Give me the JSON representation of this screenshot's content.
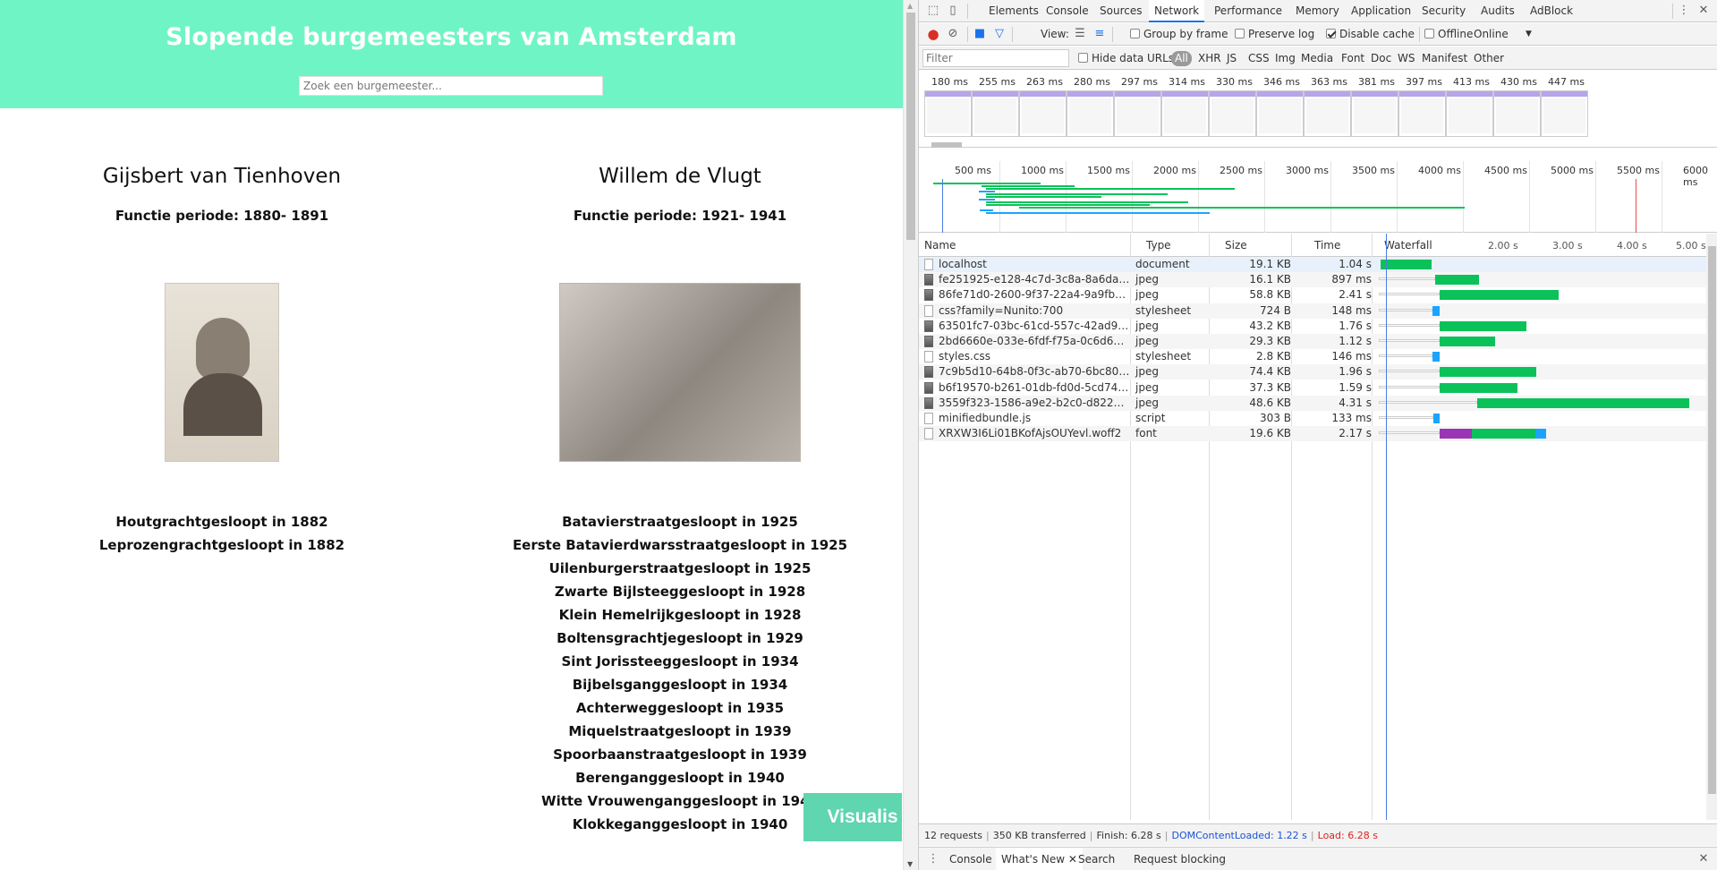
{
  "site": {
    "title": "Slopende burgemeesters van Amsterdam",
    "search_placeholder": "Zoek een burgemeester...",
    "visualis_label": "Visualis"
  },
  "mayors": [
    {
      "name": "Gijsbert van Tienhoven",
      "period": "Functie periode: 1880- 1891",
      "streets": [
        "Houtgrachtgesloopt in 1882",
        "Leprozengrachtgesloopt in 1882"
      ]
    },
    {
      "name": "Willem de Vlugt",
      "period": "Functie periode: 1921- 1941",
      "streets": [
        "Batavierstraatgesloopt in 1925",
        "Eerste Batavierdwarsstraatgesloopt in 1925",
        "Uilenburgerstraatgesloopt in 1925",
        "Zwarte Bijlsteeggesloopt in 1928",
        "Klein Hemelrijkgesloopt in 1928",
        "Boltensgrachtjegesloopt in 1929",
        "Sint Jorissteeggesloopt in 1934",
        "Bijbelsganggesloopt in 1934",
        "Achterweggesloopt in 1935",
        "Miquelstraatgesloopt in 1939",
        "Spoorbaanstraatgesloopt in 1939",
        "Berenganggesloopt in 1940",
        "Witte Vrouwenganggesloopt in 1940",
        "Klokkeganggesloopt in 1940"
      ]
    }
  ],
  "devtools": {
    "tabs": [
      "Elements",
      "Console",
      "Sources",
      "Network",
      "Performance",
      "Memory",
      "Application",
      "Security",
      "Audits",
      "AdBlock"
    ],
    "active_tab": "Network",
    "toolbar": {
      "view_label": "View:",
      "group_by_frame": "Group by frame",
      "preserve_log": "Preserve log",
      "disable_cache": "Disable cache",
      "offline": "Offline",
      "online": "Online"
    },
    "filterbar": {
      "filter_placeholder": "Filter",
      "hide_data_urls": "Hide data URLs",
      "types": [
        "All",
        "XHR",
        "JS",
        "CSS",
        "Img",
        "Media",
        "Font",
        "Doc",
        "WS",
        "Manifest",
        "Other"
      ]
    },
    "frame_times": [
      "180 ms",
      "255 ms",
      "263 ms",
      "280 ms",
      "297 ms",
      "314 ms",
      "330 ms",
      "346 ms",
      "363 ms",
      "381 ms",
      "397 ms",
      "413 ms",
      "430 ms",
      "447 ms"
    ],
    "overview_ticks": [
      "500 ms",
      "1000 ms",
      "1500 ms",
      "2000 ms",
      "2500 ms",
      "3000 ms",
      "3500 ms",
      "4000 ms",
      "4500 ms",
      "5000 ms",
      "5500 ms",
      "6000 ms"
    ],
    "columns": {
      "name": "Name",
      "type": "Type",
      "size": "Size",
      "time": "Time",
      "waterfall": "Waterfall"
    },
    "waterfall_ticks": [
      "2.00 s",
      "3.00 s",
      "4.00 s",
      "5.00 s"
    ],
    "requests": [
      {
        "name": "localhost",
        "type": "document",
        "size": "19.1 KB",
        "time": "1.04 s",
        "icon": "document-icon",
        "start_s": 0.0,
        "end_s": 1.04,
        "color": "#0bc25a"
      },
      {
        "name": "fe251925-e128-4c7d-3c8a-8a6dacf9cd...",
        "type": "jpeg",
        "size": "16.1 KB",
        "time": "897 ms",
        "icon": "image-icon",
        "start_s": 1.1,
        "end_s": 2.0,
        "color": "#0bc25a"
      },
      {
        "name": "86fe71d0-2600-9f37-22a4-9a9fb9f012d...",
        "type": "jpeg",
        "size": "58.8 KB",
        "time": "2.41 s",
        "icon": "image-icon",
        "start_s": 1.2,
        "end_s": 3.61,
        "color": "#0bc25a"
      },
      {
        "name": "css?family=Nunito:700",
        "type": "stylesheet",
        "size": "724 B",
        "time": "148 ms",
        "icon": "document-icon",
        "start_s": 1.05,
        "end_s": 1.2,
        "color": "#1ba4ff"
      },
      {
        "name": "63501fc7-03bc-61cd-557c-42ad94ee13...",
        "type": "jpeg",
        "size": "43.2 KB",
        "time": "1.76 s",
        "icon": "image-icon",
        "start_s": 1.2,
        "end_s": 2.96,
        "color": "#0bc25a"
      },
      {
        "name": "2bd6660e-033e-6fdf-f75a-0c6d663ceb...",
        "type": "jpeg",
        "size": "29.3 KB",
        "time": "1.12 s",
        "icon": "image-icon",
        "start_s": 1.2,
        "end_s": 2.32,
        "color": "#0bc25a"
      },
      {
        "name": "styles.css",
        "type": "stylesheet",
        "size": "2.8 KB",
        "time": "146 ms",
        "icon": "document-icon",
        "start_s": 1.05,
        "end_s": 1.2,
        "color": "#1ba4ff"
      },
      {
        "name": "7c9b5d10-64b8-0f3c-ab70-6bc80e62ca...",
        "type": "jpeg",
        "size": "74.4 KB",
        "time": "1.96 s",
        "icon": "image-icon",
        "start_s": 1.2,
        "end_s": 3.16,
        "color": "#0bc25a"
      },
      {
        "name": "b6f19570-b261-01db-fd0d-5cd7464ba...",
        "type": "jpeg",
        "size": "37.3 KB",
        "time": "1.59 s",
        "icon": "image-icon",
        "start_s": 1.2,
        "end_s": 2.79,
        "color": "#0bc25a"
      },
      {
        "name": "3559f323-1586-a9e2-b2c0-d8226129b...",
        "type": "jpeg",
        "size": "48.6 KB",
        "time": "4.31 s",
        "icon": "image-icon",
        "start_s": 1.97,
        "end_s": 6.28,
        "color": "#0bc25a"
      },
      {
        "name": "minifiedbundle.js",
        "type": "script",
        "size": "303 B",
        "time": "133 ms",
        "icon": "document-icon",
        "start_s": 1.07,
        "end_s": 1.2,
        "color": "#1ba4ff"
      },
      {
        "name": "XRXW3I6Li01BKofAjsOUYevl.woff2",
        "type": "font",
        "size": "19.6 KB",
        "time": "2.17 s",
        "icon": "document-icon",
        "start_s": 1.2,
        "end_s": 3.37,
        "color": "#1ba4ff"
      }
    ],
    "status": {
      "requests": "12 requests",
      "transferred": "350 KB transferred",
      "finish": "Finish: 6.28 s",
      "dom_loaded": "DOMContentLoaded: 1.22 s",
      "load": "Load: 6.28 s"
    },
    "drawer_tabs": [
      "Console",
      "What's New",
      "Search",
      "Request blocking"
    ]
  }
}
